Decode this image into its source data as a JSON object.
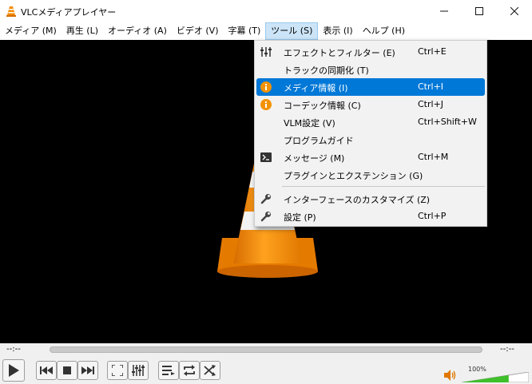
{
  "window": {
    "title": "VLCメディアプレイヤー"
  },
  "menubar": [
    {
      "label": "メディア (M)"
    },
    {
      "label": "再生 (L)"
    },
    {
      "label": "オーディオ (A)"
    },
    {
      "label": "ビデオ (V)"
    },
    {
      "label": "字幕 (T)"
    },
    {
      "label": "ツール (S)"
    },
    {
      "label": "表示 (I)"
    },
    {
      "label": "ヘルプ (H)"
    }
  ],
  "tools_menu": {
    "items": [
      {
        "label": "エフェクトとフィルター (E)",
        "shortcut": "Ctrl+E",
        "icon": "equalizer-icon"
      },
      {
        "label": "トラックの同期化 (T)",
        "shortcut": "",
        "icon": ""
      },
      {
        "label": "メディア情報 (I)",
        "shortcut": "Ctrl+I",
        "icon": "info-icon",
        "highlighted": true
      },
      {
        "label": "コーデック情報 (C)",
        "shortcut": "Ctrl+J",
        "icon": "info-icon"
      },
      {
        "label": "VLM設定 (V)",
        "shortcut": "Ctrl+Shift+W",
        "icon": ""
      },
      {
        "label": "プログラムガイド",
        "shortcut": "",
        "icon": ""
      },
      {
        "label": "メッセージ (M)",
        "shortcut": "Ctrl+M",
        "icon": "terminal-icon"
      },
      {
        "label": "プラグインとエクステンション (G)",
        "shortcut": "",
        "icon": ""
      },
      {
        "label": "インターフェースのカスタマイズ (Z)",
        "shortcut": "",
        "icon": "wrench-icon"
      },
      {
        "label": "設定 (P)",
        "shortcut": "Ctrl+P",
        "icon": "wrench-icon"
      }
    ]
  },
  "controls": {
    "time_elapsed": "--:--",
    "time_total": "--:--",
    "volume_label": "100%",
    "volume_level": 0.7
  },
  "colors": {
    "highlight": "#0078d7",
    "cone_orange": "#f48a00",
    "info_orange": "#f39200",
    "volume_green": "#3fbf2a"
  }
}
